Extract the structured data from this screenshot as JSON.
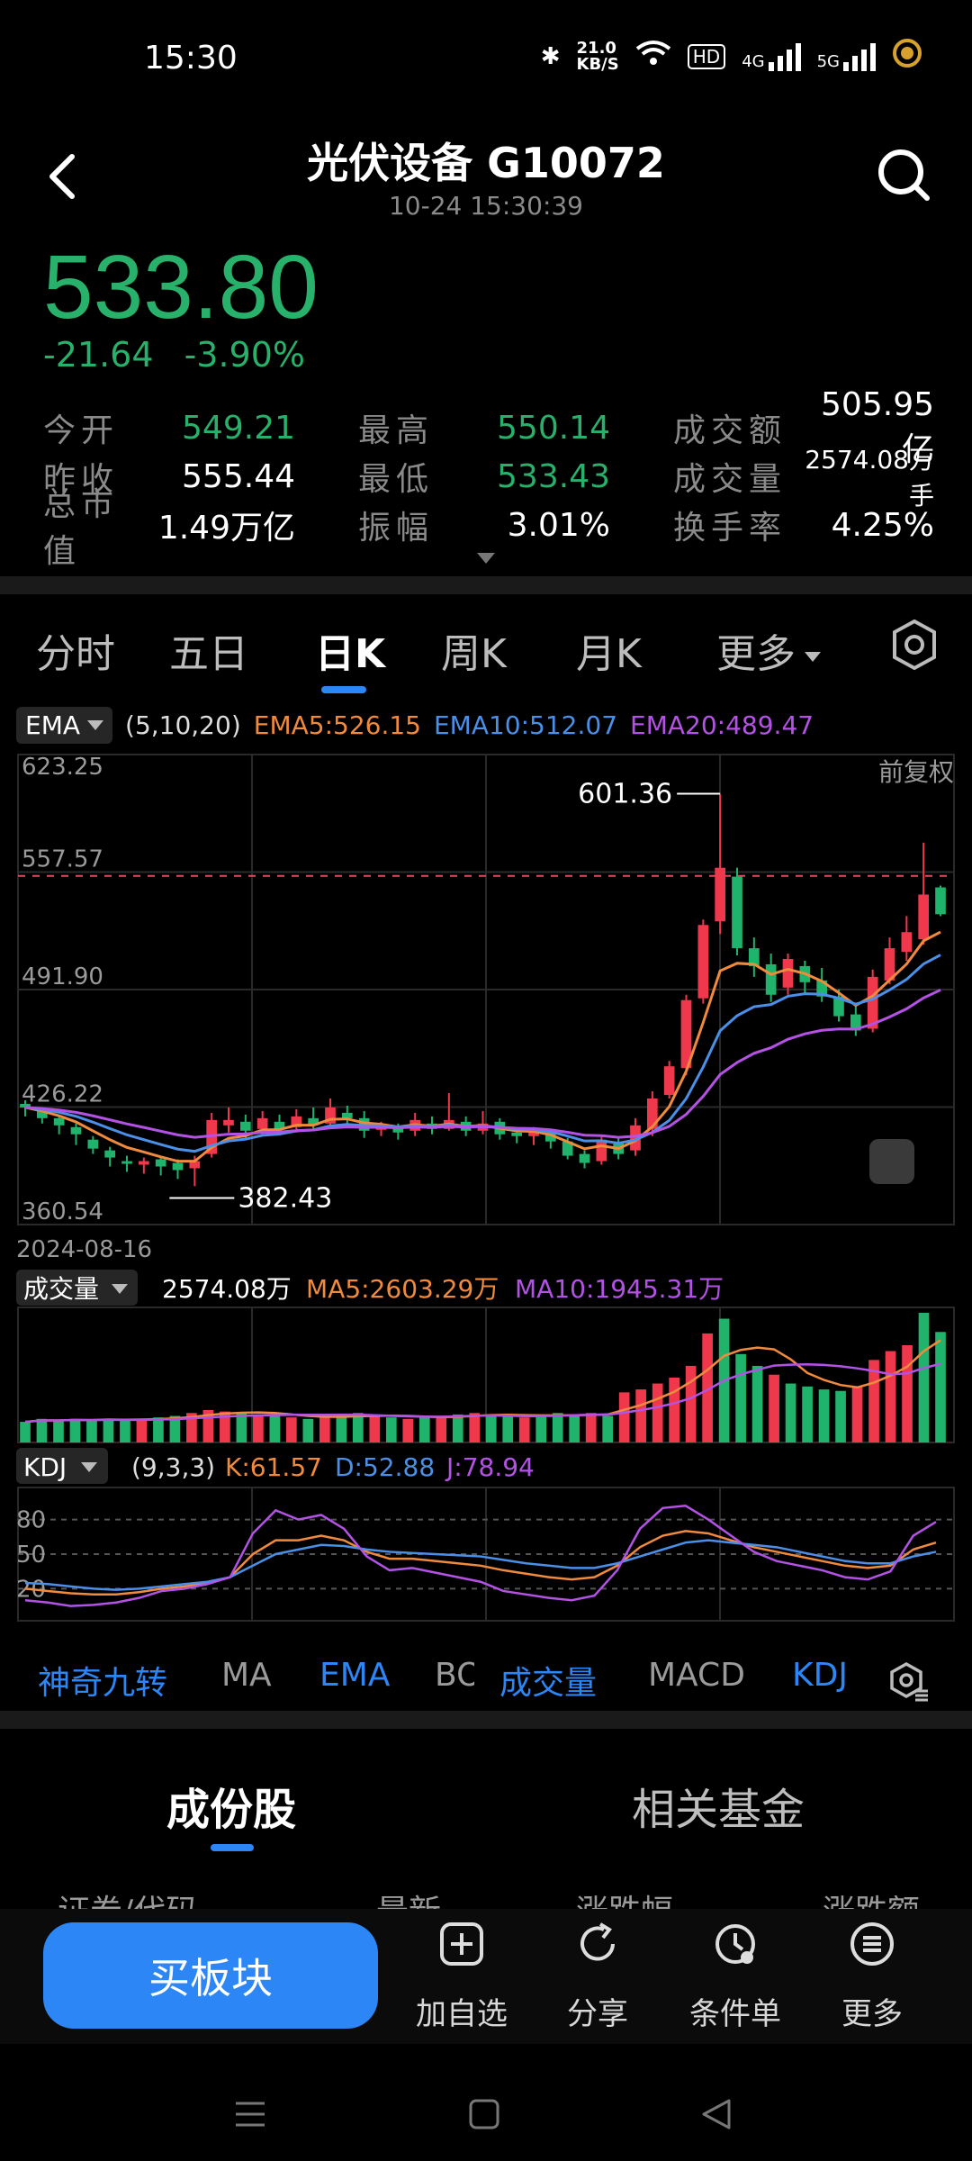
{
  "status": {
    "time": "15:30",
    "net_speed_top": "21.0",
    "net_speed_unit": "KB/S",
    "hd": "HD",
    "sig1": "4G",
    "sig2": "5G"
  },
  "header": {
    "title": "光伏设备 G10072",
    "timestamp": "10-24 15:30:39"
  },
  "quote": {
    "price": "533.80",
    "change": "-21.64",
    "change_pct": "-3.90%",
    "stats": [
      [
        {
          "label": "今开",
          "value": "549.21",
          "color": "green"
        },
        {
          "label": "最高",
          "value": "550.14",
          "color": "green"
        },
        {
          "label": "成交额",
          "value": "505.95亿",
          "color": "white"
        }
      ],
      [
        {
          "label": "昨收",
          "value": "555.44",
          "color": "white"
        },
        {
          "label": "最低",
          "value": "533.43",
          "color": "green"
        },
        {
          "label": "成交量",
          "value": "2574.08万手",
          "color": "white"
        }
      ],
      [
        {
          "label": "总市值",
          "value": "1.49万亿",
          "color": "white"
        },
        {
          "label": "振幅",
          "value": "3.01%",
          "color": "white"
        },
        {
          "label": "换手率",
          "value": "4.25%",
          "color": "white"
        }
      ]
    ]
  },
  "tabs": [
    "分时",
    "五日",
    "日K",
    "周K",
    "月K",
    "更多"
  ],
  "active_tab": "日K",
  "ema": {
    "chip": "EMA",
    "params": "(5,10,20)",
    "ema5": "EMA5:526.15",
    "ema10": "EMA10:512.07",
    "ema20": "EMA20:489.47"
  },
  "kchart": {
    "adjust_label": "前复权",
    "y_ticks": [
      "623.25",
      "557.57",
      "491.90",
      "426.22",
      "360.54"
    ],
    "start_date": "2024-08-16",
    "high_label": "601.36",
    "low_label": "382.43"
  },
  "volume": {
    "chip": "成交量",
    "value": "2574.08万",
    "ma5": "MA5:2603.29万",
    "ma10": "MA10:1945.31万"
  },
  "kdj": {
    "chip": "KDJ",
    "params": "(9,3,3)",
    "k": "K:61.57",
    "d": "D:52.88",
    "j": "J:78.94",
    "levels": [
      "80",
      "50",
      "20"
    ]
  },
  "indicators": [
    {
      "label": "神奇九转",
      "active": true
    },
    {
      "label": "MA",
      "active": false
    },
    {
      "label": "EMA",
      "active": true
    },
    {
      "label": "BO",
      "active": false
    },
    {
      "label": "成交量",
      "active": true
    },
    {
      "label": "MACD",
      "active": false
    },
    {
      "label": "KDJ",
      "active": true
    }
  ],
  "sub_tabs": [
    "成份股",
    "相关基金"
  ],
  "columns": [
    "证券/代码",
    "最新",
    "涨跌幅",
    "涨跌额"
  ],
  "bottom": {
    "buy": "买板块",
    "items": [
      "加自选",
      "分享",
      "条件单",
      "更多"
    ]
  },
  "colors": {
    "up": "#f0384d",
    "down": "#1fb36b",
    "accent": "#2d86f5",
    "ema5": "#f08a3c",
    "ema10": "#4a8fe8",
    "ema20": "#b452e6"
  },
  "chart_data": {
    "type": "candlestick",
    "ylim": [
      360.54,
      623.25
    ],
    "high": 601.36,
    "low": 382.43,
    "candles": [
      [
        428,
        426,
        430,
        421
      ],
      [
        424,
        420,
        425,
        417
      ],
      [
        420,
        416,
        421,
        411
      ],
      [
        415,
        411,
        417,
        405
      ],
      [
        408,
        403,
        410,
        400
      ],
      [
        402,
        398,
        404,
        393
      ],
      [
        396,
        395,
        399,
        390
      ],
      [
        394,
        396,
        398,
        389
      ],
      [
        397,
        393,
        399,
        388
      ],
      [
        395,
        391,
        397,
        386
      ],
      [
        392,
        396,
        399,
        382
      ],
      [
        400,
        419,
        423,
        398
      ],
      [
        416,
        419,
        426,
        412
      ],
      [
        418,
        413,
        422,
        409
      ],
      [
        414,
        420,
        424,
        410
      ],
      [
        418,
        414,
        422,
        411
      ],
      [
        415,
        421,
        425,
        412
      ],
      [
        420,
        416,
        426,
        413
      ],
      [
        417,
        426,
        431,
        414
      ],
      [
        423,
        420,
        427,
        416
      ],
      [
        420,
        413,
        424,
        409
      ],
      [
        414,
        415,
        418,
        410
      ],
      [
        415,
        412,
        417,
        408
      ],
      [
        413,
        419,
        423,
        410
      ],
      [
        417,
        414,
        421,
        411
      ],
      [
        414,
        419,
        434,
        413
      ],
      [
        418,
        413,
        421,
        410
      ],
      [
        413,
        417,
        424,
        411
      ],
      [
        418,
        411,
        420,
        408
      ],
      [
        412,
        410,
        414,
        406
      ],
      [
        410,
        412,
        415,
        405
      ],
      [
        412,
        407,
        414,
        403
      ],
      [
        407,
        399,
        409,
        397
      ],
      [
        400,
        395,
        402,
        392
      ],
      [
        396,
        408,
        410,
        394
      ],
      [
        406,
        400,
        409,
        397
      ],
      [
        402,
        416,
        420,
        399
      ],
      [
        414,
        431,
        435,
        410
      ],
      [
        433,
        449,
        452,
        431
      ],
      [
        448,
        486,
        489,
        444
      ],
      [
        487,
        528,
        531,
        484
      ],
      [
        530,
        560,
        601,
        523
      ],
      [
        555,
        515,
        560,
        511
      ],
      [
        515,
        505,
        521,
        499
      ],
      [
        506,
        489,
        512,
        485
      ],
      [
        493,
        509,
        512,
        489
      ],
      [
        505,
        496,
        508,
        490
      ],
      [
        497,
        488,
        504,
        485
      ],
      [
        488,
        477,
        492,
        474
      ],
      [
        478,
        469,
        483,
        466
      ],
      [
        470,
        499,
        503,
        468
      ],
      [
        497,
        515,
        521,
        495
      ],
      [
        513,
        524,
        533,
        508
      ],
      [
        520,
        545,
        574,
        517
      ],
      [
        549,
        534,
        550,
        533
      ]
    ],
    "volume": [
      14,
      16,
      15,
      16,
      15,
      16,
      15,
      16,
      17,
      18,
      20,
      22,
      21,
      20,
      19,
      18,
      17,
      16,
      17,
      19,
      20,
      18,
      17,
      16,
      17,
      18,
      19,
      20,
      19,
      18,
      17,
      18,
      20,
      19,
      20,
      18,
      34,
      36,
      40,
      44,
      52,
      74,
      84,
      60,
      52,
      46,
      40,
      38,
      36,
      35,
      38,
      56,
      62,
      66,
      88,
      75
    ],
    "kdj_k": [
      20,
      18,
      16,
      15,
      15,
      17,
      20,
      22,
      25,
      30,
      50,
      62,
      62,
      66,
      62,
      52,
      46,
      46,
      44,
      42,
      40,
      36,
      33,
      30,
      28,
      30,
      40,
      56,
      66,
      70,
      68,
      62,
      56,
      52,
      48,
      44,
      40,
      38,
      40,
      54,
      60
    ],
    "kdj_d": [
      25,
      24,
      22,
      20,
      19,
      20,
      22,
      24,
      26,
      30,
      40,
      50,
      54,
      58,
      57,
      54,
      52,
      51,
      50,
      49,
      48,
      45,
      42,
      40,
      38,
      38,
      42,
      48,
      54,
      60,
      62,
      60,
      58,
      56,
      52,
      48,
      44,
      42,
      42,
      48,
      52
    ],
    "kdj_j": [
      10,
      8,
      5,
      6,
      8,
      12,
      18,
      20,
      24,
      30,
      68,
      88,
      80,
      84,
      72,
      48,
      36,
      38,
      34,
      30,
      26,
      18,
      15,
      12,
      10,
      14,
      36,
      72,
      90,
      92,
      80,
      66,
      52,
      44,
      40,
      36,
      30,
      28,
      35,
      66,
      78
    ]
  }
}
